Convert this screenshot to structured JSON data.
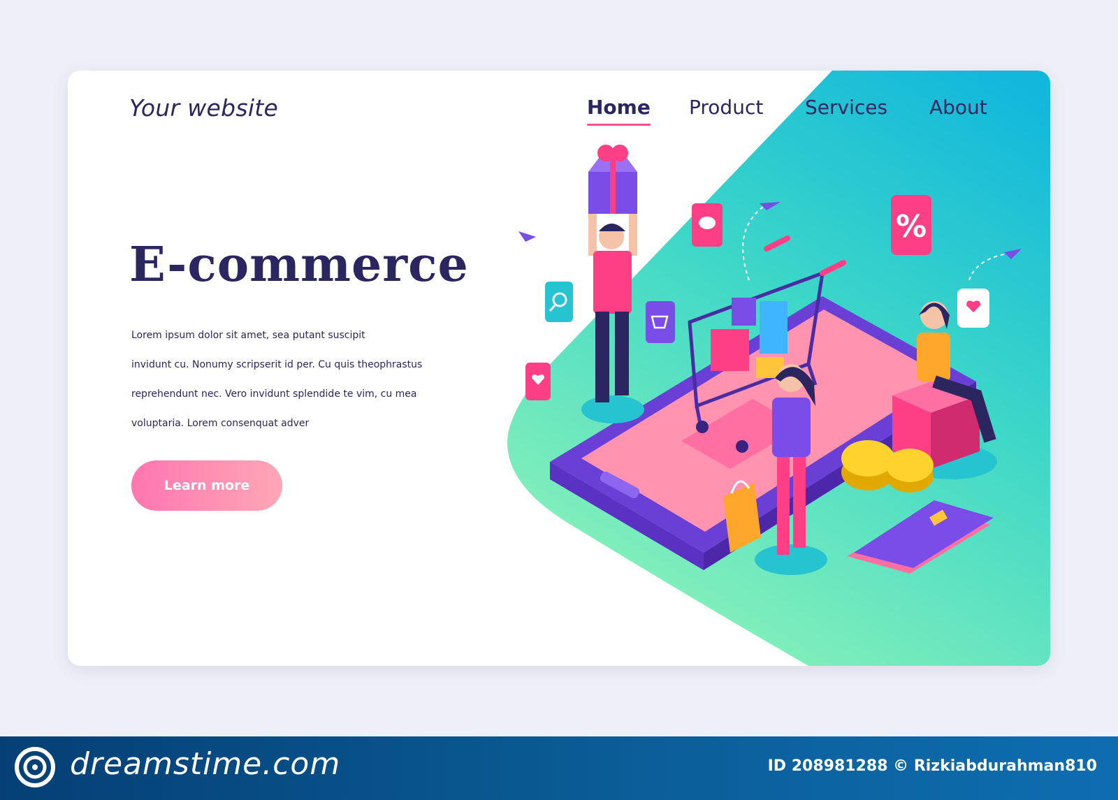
{
  "header": {
    "logo_text": "Your website",
    "nav": [
      {
        "label": "Home",
        "active": true
      },
      {
        "label": "Product",
        "active": false
      },
      {
        "label": "Services",
        "active": false
      },
      {
        "label": "About",
        "active": false
      }
    ]
  },
  "hero": {
    "title": "E-commerce",
    "body_lines": [
      "Lorem ipsum dolor sit amet, sea putant suscipit",
      "invidunt cu. Nonumy scripserit id per. Cu quis theophrastus",
      "reprehendunt nec. Vero invidunt splendide te vim, cu mea",
      "voluptaria. Lorem consenquat adver"
    ],
    "cta_label": "Learn more"
  },
  "illustration": {
    "discount_badge": "%",
    "icons": [
      "gift-icon",
      "search-icon",
      "cart-icon",
      "chat-icon",
      "heart-icon",
      "percent-icon",
      "credit-card-icon",
      "coin-icon",
      "shopping-bag-icon"
    ]
  },
  "footer": {
    "brand": "dreamstime.com",
    "id_text": "ID 208981288 © Rizkiabdurahman810"
  },
  "colors": {
    "navy": "#2b2560",
    "accent_pink": "#ff4f8b",
    "cta_start": "#ff76b0",
    "cta_end": "#ffa7b6",
    "gradient_top": "#12b7dc",
    "gradient_bottom": "#8af2b8",
    "phone_purple": "#7a4de8",
    "footer_blue": "#0b5f9a"
  }
}
